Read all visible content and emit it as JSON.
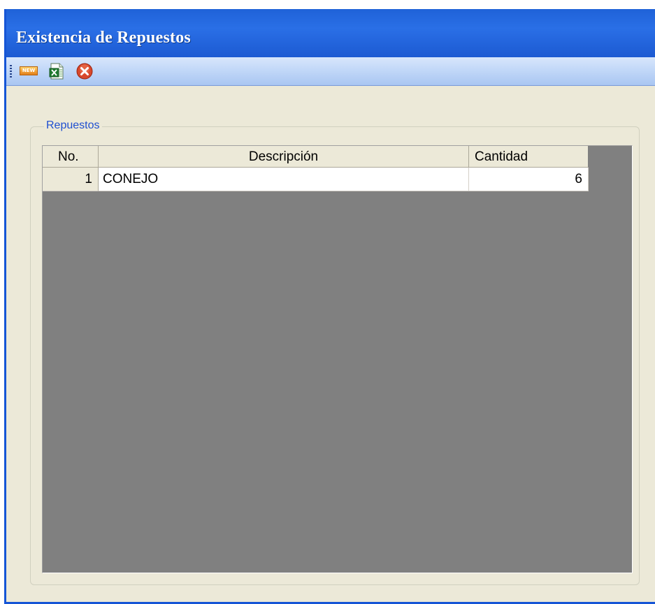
{
  "window": {
    "title": "Existencia de Repuestos"
  },
  "toolbar": {
    "new_icon_text": "NEW",
    "buttons": [
      {
        "name": "new",
        "icon": "new-icon"
      },
      {
        "name": "export-excel",
        "icon": "excel-icon"
      },
      {
        "name": "close",
        "icon": "close-icon"
      }
    ]
  },
  "group": {
    "label": "Repuestos"
  },
  "grid": {
    "columns": [
      "No.",
      "Descripción",
      "Cantidad"
    ],
    "rows": [
      {
        "no": "1",
        "descripcion": "CONEJO",
        "cantidad": "6"
      }
    ]
  },
  "colors": {
    "title_bar": "#2a6fe6",
    "toolbar": "#c2d8f8",
    "form_background": "#ece9d8",
    "grid_background": "#808080",
    "group_label": "#1f4fd0"
  }
}
